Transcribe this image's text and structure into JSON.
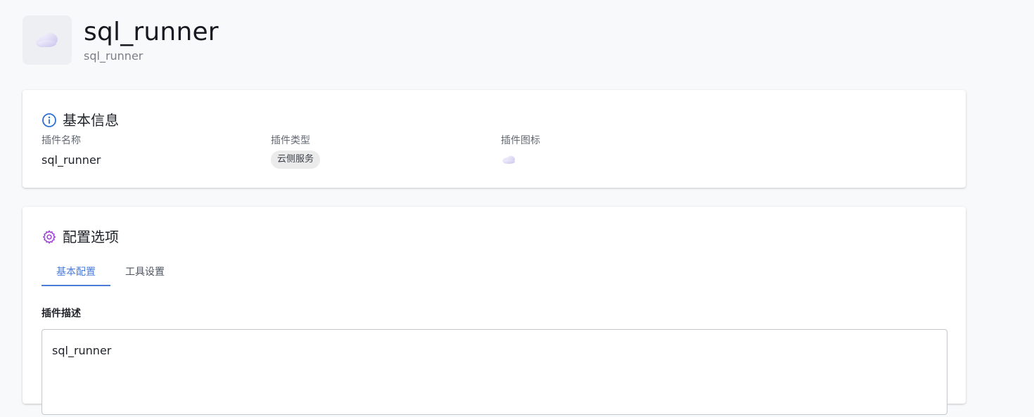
{
  "header": {
    "title": "sql_runner",
    "subtitle": "sql_runner",
    "avatar_icon": "cloud-icon"
  },
  "basic_info": {
    "heading": "基本信息",
    "heading_icon": "info-icon",
    "name_label": "插件名称",
    "name_value": "sql_runner",
    "type_label": "插件类型",
    "type_value": "云侧服务",
    "icon_label": "插件图标",
    "icon_value": "cloud-icon"
  },
  "config": {
    "heading": "配置选项",
    "heading_icon": "gear-icon",
    "tabs": [
      {
        "label": "基本配置",
        "active": true
      },
      {
        "label": "工具设置",
        "active": false
      }
    ],
    "description_label": "插件描述",
    "description_value": "sql_runner"
  },
  "colors": {
    "accent": "#4b7bd8",
    "config_icon": "#9b3fd6",
    "info_icon": "#2f6fd6",
    "page_bg": "#f8f9fb"
  }
}
